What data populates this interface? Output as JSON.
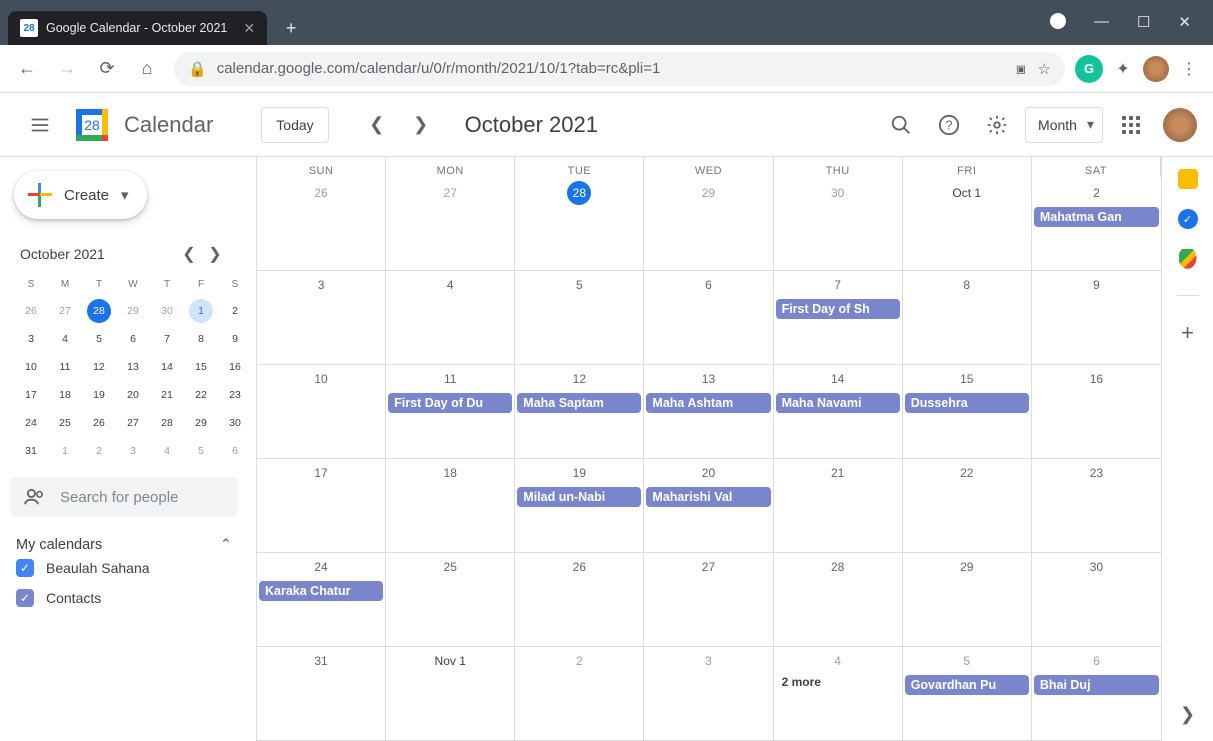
{
  "browser": {
    "tab_title": "Google Calendar - October 2021",
    "favicon_text": "28",
    "url": "calendar.google.com/calendar/u/0/r/month/2021/10/1?tab=rc&pli=1"
  },
  "header": {
    "app_name": "Calendar",
    "logo_day": "28",
    "today_label": "Today",
    "month_title": "October 2021",
    "view_label": "Month"
  },
  "sidebar": {
    "create_label": "Create",
    "mini": {
      "title": "October 2021",
      "dow": [
        "S",
        "M",
        "T",
        "W",
        "T",
        "F",
        "S"
      ],
      "weeks": [
        [
          {
            "d": "26",
            "o": true
          },
          {
            "d": "27",
            "o": true
          },
          {
            "d": "28",
            "o": true,
            "today": true
          },
          {
            "d": "29",
            "o": true
          },
          {
            "d": "30",
            "o": true
          },
          {
            "d": "1",
            "sel": true
          },
          {
            "d": "2"
          }
        ],
        [
          {
            "d": "3"
          },
          {
            "d": "4"
          },
          {
            "d": "5"
          },
          {
            "d": "6"
          },
          {
            "d": "7"
          },
          {
            "d": "8"
          },
          {
            "d": "9"
          }
        ],
        [
          {
            "d": "10"
          },
          {
            "d": "11"
          },
          {
            "d": "12"
          },
          {
            "d": "13"
          },
          {
            "d": "14"
          },
          {
            "d": "15"
          },
          {
            "d": "16"
          }
        ],
        [
          {
            "d": "17"
          },
          {
            "d": "18"
          },
          {
            "d": "19"
          },
          {
            "d": "20"
          },
          {
            "d": "21"
          },
          {
            "d": "22"
          },
          {
            "d": "23"
          }
        ],
        [
          {
            "d": "24"
          },
          {
            "d": "25"
          },
          {
            "d": "26"
          },
          {
            "d": "27"
          },
          {
            "d": "28"
          },
          {
            "d": "29"
          },
          {
            "d": "30"
          }
        ],
        [
          {
            "d": "31"
          },
          {
            "d": "1",
            "o": true
          },
          {
            "d": "2",
            "o": true
          },
          {
            "d": "3",
            "o": true
          },
          {
            "d": "4",
            "o": true
          },
          {
            "d": "5",
            "o": true
          },
          {
            "d": "6",
            "o": true
          }
        ]
      ]
    },
    "search_placeholder": "Search for people",
    "my_cal_label": "My calendars",
    "calendars": [
      {
        "name": "Beaulah Sahana",
        "color": "blue"
      },
      {
        "name": "Contacts",
        "color": "violet"
      }
    ]
  },
  "grid": {
    "dow": [
      "SUN",
      "MON",
      "TUE",
      "WED",
      "THU",
      "FRI",
      "SAT"
    ],
    "cells": [
      [
        {
          "n": "26",
          "o": true
        },
        {
          "n": "27",
          "o": true
        },
        {
          "n": "28",
          "o": true,
          "today": true
        },
        {
          "n": "29",
          "o": true
        },
        {
          "n": "30",
          "o": true
        },
        {
          "n": "Oct 1",
          "first": true
        },
        {
          "n": "2",
          "events": [
            "Mahatma Gan"
          ]
        }
      ],
      [
        {
          "n": "3"
        },
        {
          "n": "4"
        },
        {
          "n": "5"
        },
        {
          "n": "6"
        },
        {
          "n": "7",
          "events": [
            "First Day of Sh"
          ]
        },
        {
          "n": "8"
        },
        {
          "n": "9"
        }
      ],
      [
        {
          "n": "10"
        },
        {
          "n": "11",
          "events": [
            "First Day of Du"
          ]
        },
        {
          "n": "12",
          "events": [
            "Maha Saptam"
          ]
        },
        {
          "n": "13",
          "events": [
            "Maha Ashtam"
          ]
        },
        {
          "n": "14",
          "events": [
            "Maha Navami"
          ]
        },
        {
          "n": "15",
          "events": [
            "Dussehra"
          ]
        },
        {
          "n": "16"
        }
      ],
      [
        {
          "n": "17"
        },
        {
          "n": "18"
        },
        {
          "n": "19",
          "events": [
            "Milad un-Nabi"
          ]
        },
        {
          "n": "20",
          "events": [
            "Maharishi Val"
          ]
        },
        {
          "n": "21"
        },
        {
          "n": "22"
        },
        {
          "n": "23"
        }
      ],
      [
        {
          "n": "24",
          "events": [
            "Karaka Chatur"
          ]
        },
        {
          "n": "25"
        },
        {
          "n": "26"
        },
        {
          "n": "27"
        },
        {
          "n": "28"
        },
        {
          "n": "29"
        },
        {
          "n": "30"
        }
      ],
      [
        {
          "n": "31"
        },
        {
          "n": "Nov 1",
          "o": true,
          "first": true
        },
        {
          "n": "2",
          "o": true
        },
        {
          "n": "3",
          "o": true
        },
        {
          "n": "4",
          "o": true,
          "more": "2 more"
        },
        {
          "n": "5",
          "o": true,
          "events": [
            "Govardhan Pu"
          ]
        },
        {
          "n": "6",
          "o": true,
          "events": [
            "Bhai Duj"
          ]
        }
      ]
    ]
  }
}
